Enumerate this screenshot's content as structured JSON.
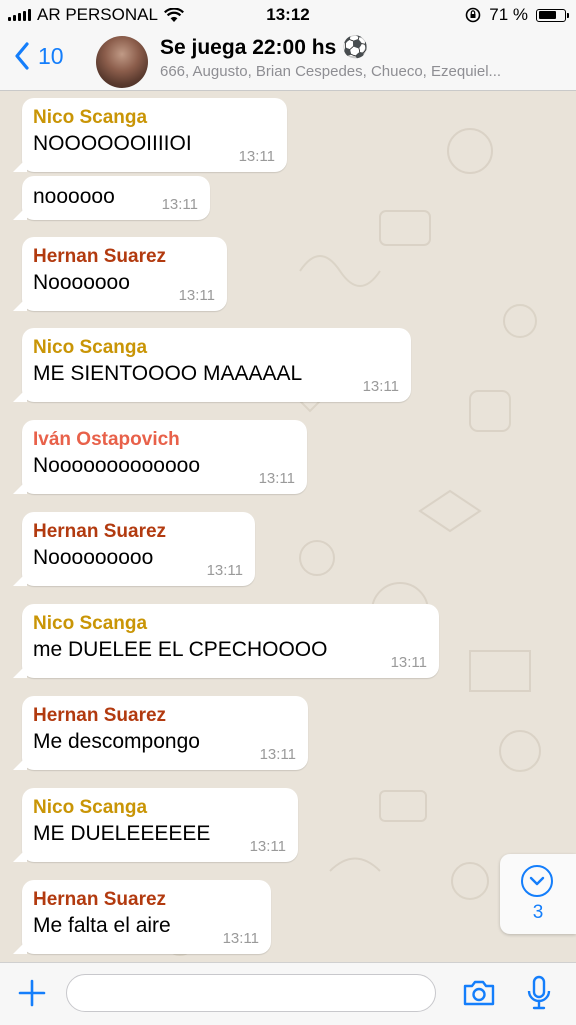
{
  "status_bar": {
    "carrier": "AR PERSONAL",
    "time": "13:12",
    "battery": "71 %",
    "battery_level": 0.71
  },
  "header": {
    "back_count": "10",
    "title": "Se juega 22:00 hs ⚽",
    "subtitle": "666, Augusto, Brian Cespedes, Chueco, Ezequiel..."
  },
  "messages": [
    {
      "sender": "Nico Scanga",
      "text": "NOOOOOOIIIIOI",
      "time": "13:11"
    },
    {
      "sender": "",
      "text": "noooooo",
      "time": "13:11"
    },
    {
      "sender": "Hernan Suarez",
      "text": "Nooooooo",
      "time": "13:11"
    },
    {
      "sender": "Nico Scanga",
      "text": "ME SIENTOOOO MAAAAAL",
      "time": "13:11"
    },
    {
      "sender": "Iván Ostapovich",
      "text": "Nooooooooooooo",
      "time": "13:11"
    },
    {
      "sender": "Hernan Suarez",
      "text": "Nooooooooo",
      "time": "13:11"
    },
    {
      "sender": "Nico Scanga",
      "text": "me DUELEE EL CPECHOOOO",
      "time": "13:11"
    },
    {
      "sender": "Hernan Suarez",
      "text": "Me descompongo",
      "time": "13:11"
    },
    {
      "sender": "Nico Scanga",
      "text": "ME DUELEEEEEE",
      "time": "13:11"
    },
    {
      "sender": "Hernan Suarez",
      "text": "Me falta el aire",
      "time": "13:11"
    }
  ],
  "scroll_down": {
    "unread_count": "3"
  },
  "input": {
    "value": "",
    "placeholder": ""
  },
  "icons": [
    "signal-icon",
    "wifi-icon",
    "orientation-lock-icon",
    "battery-icon",
    "back-chevron-icon",
    "plus-icon",
    "camera-icon",
    "microphone-icon",
    "chevron-down-icon"
  ],
  "colors": {
    "accent": "#147efb",
    "nico": "#c99506",
    "hernan": "#b23a0f",
    "ivan": "#e8614a",
    "wallpaper": "#e9e3d9"
  }
}
